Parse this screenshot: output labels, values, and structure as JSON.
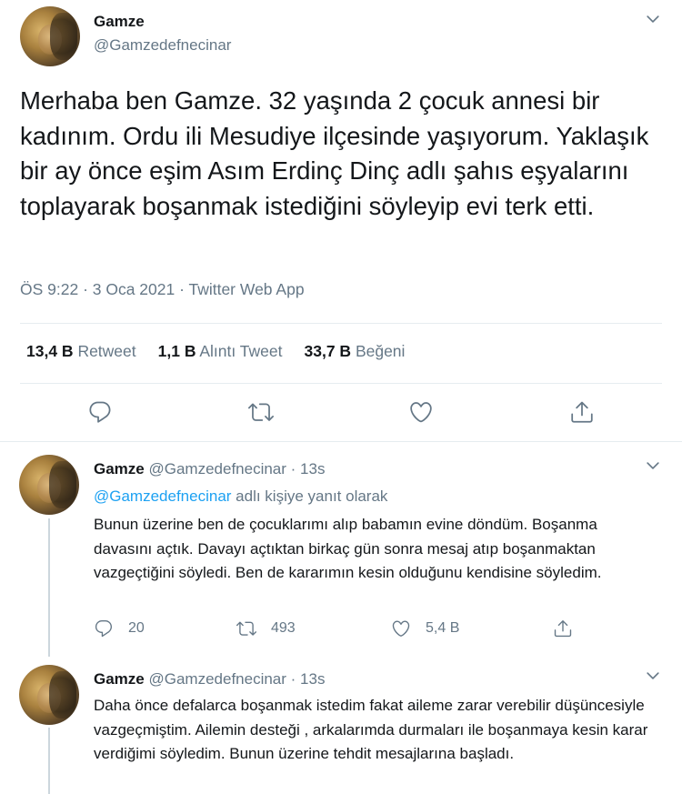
{
  "main_tweet": {
    "display_name": "Gamze",
    "handle": "@Gamzedefnecinar",
    "text": "Merhaba ben Gamze. 32 yaşında 2 çocuk annesi bir kadınım. Ordu ili Mesudiye ilçesinde yaşıyorum. Yaklaşık bir ay önce eşim Asım Erdinç Dinç adlı şahıs eşyalarını toplayarak boşanmak istediğini söyleyip evi terk etti.",
    "meta": "ÖS 9:22 · 3 Oca 2021 · Twitter Web App",
    "stats": {
      "retweet_count": "13,4 B",
      "retweet_label": "Retweet",
      "quote_count": "1,1 B",
      "quote_label": "Alıntı Tweet",
      "like_count": "33,7 B",
      "like_label": "Beğeni"
    }
  },
  "replies": [
    {
      "display_name": "Gamze",
      "handle_time": "@Gamzedefnecinar · 13s",
      "reply_to_handle": "@Gamzedefnecinar",
      "reply_to_suffix": " adlı kişiye yanıt olarak",
      "text": "Bunun üzerine ben de çocuklarımı alıp babamın evine döndüm. Boşanma davasını açtık. Davayı açtıktan birkaç gün sonra mesaj atıp boşanmaktan vazgeçtiğini söyledi. Ben de kararımın kesin olduğunu kendisine söyledim.",
      "reply_count": "20",
      "retweet_count": "493",
      "like_count": "5,4 B"
    },
    {
      "display_name": "Gamze",
      "handle_time": "@Gamzedefnecinar · 13s",
      "text": "Daha önce defalarca boşanmak  istedim fakat aileme zarar verebilir düşüncesiyle vazgeçmiştim. Ailemin desteği , arkalarımda durmaları ile boşanmaya kesin karar verdiğimi söyledim. Bunun üzerine tehdit mesajlarına başladı."
    }
  ],
  "icons": {
    "reply": "reply-icon",
    "retweet": "retweet-icon",
    "like": "heart-icon",
    "share": "share-icon",
    "more": "chevron-down-icon"
  },
  "colors": {
    "text": "#14171a",
    "secondary": "#657786",
    "link": "#1da1f2",
    "divider": "#e6ecf0"
  }
}
